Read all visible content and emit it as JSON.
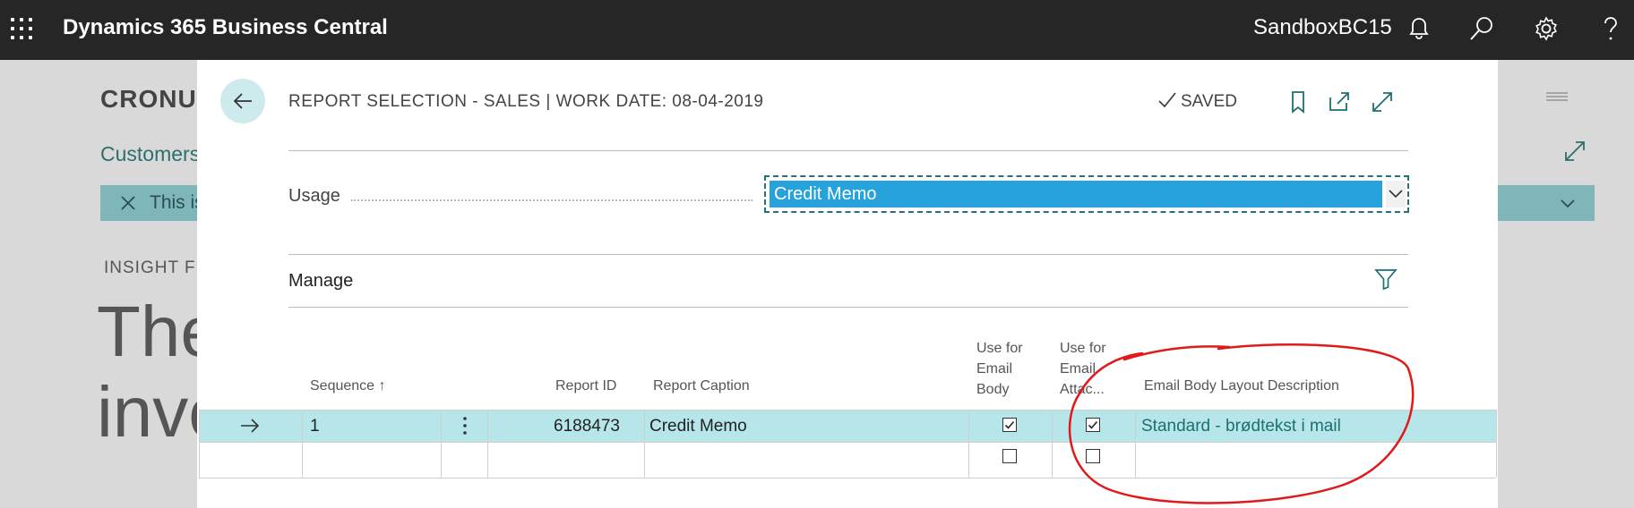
{
  "topbar": {
    "app_title": "Dynamics 365 Business Central",
    "environment": "SandboxBC15",
    "icons": [
      "waffle-icon",
      "bell-icon",
      "search-icon",
      "gear-icon",
      "help-icon"
    ]
  },
  "background_page": {
    "company": "CRONUS",
    "breadcrumb": "Customers",
    "notice_text": "This is",
    "insight_label": "INSIGHT FR",
    "headline_line1": "The",
    "headline_line2": "invo"
  },
  "dialog": {
    "title": "REPORT SELECTION - SALES | WORK DATE: 08-04-2019",
    "saved_label": "SAVED",
    "usage_label": "Usage",
    "usage_value": "Credit Memo",
    "manage_label": "Manage",
    "table": {
      "headers": {
        "sequence": "Sequence",
        "report_id": "Report ID",
        "report_caption": "Report Caption",
        "use_email_body": [
          "Use for",
          "Email",
          "Body"
        ],
        "use_email_attachment": [
          "Use for",
          "Email",
          "Attac..."
        ],
        "email_body_layout_description": "Email Body Layout Description"
      },
      "rows": [
        {
          "sequence": "1",
          "report_id": "6188473",
          "report_caption": "Credit Memo",
          "use_email_body": true,
          "use_email_attachment": true,
          "email_body_layout_description": "Standard - brødtekst i mail"
        },
        {
          "sequence": "",
          "report_id": "",
          "report_caption": "",
          "use_email_body": false,
          "use_email_attachment": false,
          "email_body_layout_description": ""
        }
      ]
    }
  },
  "colors": {
    "topbar": "#262626",
    "accent_teal": "#1d6f71",
    "selected_row": "#b6e6e9",
    "usage_highlight": "#28a2db",
    "annotation_red": "#e0191b"
  }
}
